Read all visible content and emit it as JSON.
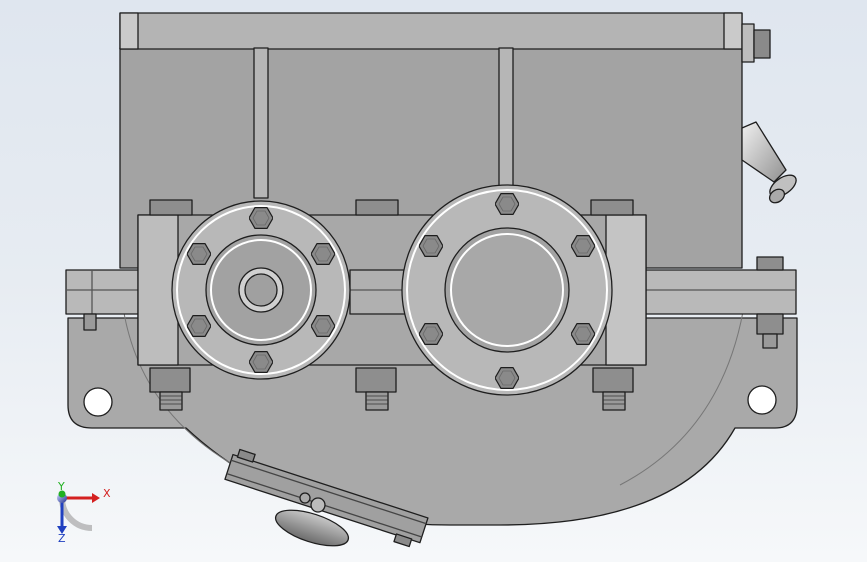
{
  "viewport": {
    "background_top": "#dfe6ef",
    "background_bottom": "#f6f8fa"
  },
  "model": {
    "body_color": "#a5a5a5",
    "edge_color": "#1e1e1e",
    "highlight_color": "#ffffff",
    "bolt_color": "#8c8c8c"
  },
  "triad": {
    "x_label": "X",
    "y_label": "Y",
    "z_label": "Z",
    "x_color": "#d42020",
    "y_color": "#20b020",
    "z_color": "#2040c0"
  }
}
